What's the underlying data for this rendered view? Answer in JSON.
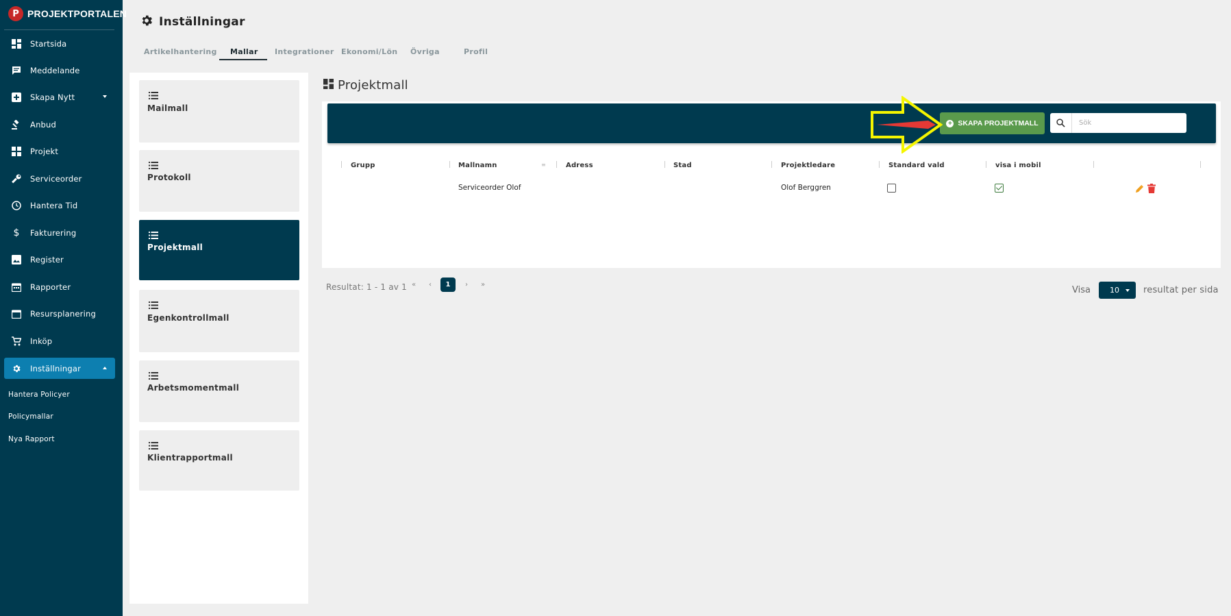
{
  "brand": {
    "logo_letter": "P",
    "name": "PROJEKTPORTALEN"
  },
  "sidebar": {
    "items": [
      {
        "label": "Startsida",
        "icon": "dashboard-icon"
      },
      {
        "label": "Meddelande",
        "icon": "message-icon"
      },
      {
        "label": "Skapa Nytt",
        "icon": "add-box-icon",
        "expandable": true
      },
      {
        "label": "Anbud",
        "icon": "gavel-icon"
      },
      {
        "label": "Projekt",
        "icon": "projects-icon"
      },
      {
        "label": "Serviceorder",
        "icon": "wrench-icon"
      },
      {
        "label": "Hantera Tid",
        "icon": "clock-icon"
      },
      {
        "label": "Fakturering",
        "icon": "dollar-icon"
      },
      {
        "label": "Register",
        "icon": "image-icon"
      },
      {
        "label": "Rapporter",
        "icon": "calendar-report-icon"
      },
      {
        "label": "Resursplanering",
        "icon": "calendar-icon"
      },
      {
        "label": "Inköp",
        "icon": "cart-icon"
      },
      {
        "label": "Inställningar",
        "icon": "gear-icon",
        "active": true,
        "expanded": true
      }
    ],
    "sub_items": [
      "Hantera Policyer",
      "Policymallar",
      "Nya Rapport"
    ]
  },
  "header": {
    "title": "Inställningar",
    "tabs": [
      "Artikelhantering",
      "Mallar",
      "Integrationer",
      "Ekonomi/Lön",
      "Övriga",
      "Profil"
    ],
    "active_tab": "Mallar"
  },
  "templates": {
    "items": [
      "Mailmall",
      "Protokoll",
      "Projektmall",
      "Egenkontrollmall",
      "Arbetsmomentmall",
      "Klientrapportmall"
    ],
    "active": "Projektmall"
  },
  "main": {
    "section_title": "Projektmall",
    "create_button": "SKAPA PROJEKTMALL",
    "search_placeholder": "Sök",
    "columns": [
      "Grupp",
      "Mallnamn",
      "Adress",
      "Stad",
      "Projektledare",
      "Standard vald",
      "visa i mobil"
    ],
    "rows": [
      {
        "grupp": "",
        "mallnamn": "Serviceorder Olof",
        "adress": "",
        "stad": "",
        "projektledare": "Olof Berggren",
        "standard_vald": false,
        "visa_i_mobil": true
      }
    ]
  },
  "pagination": {
    "result_text": "Resultat: 1 - 1 av 1",
    "first": "«",
    "prev": "‹",
    "current_page": "1",
    "next": "›",
    "last": "»",
    "visa_label": "Visa",
    "page_size": "10",
    "per_page_label": "resultat per sida"
  },
  "colors": {
    "sidebar_bg": "#003a4f",
    "active_nav": "#0d7fb0",
    "create_button": "#5a9a4c",
    "highlight_arrow": "#f5f500",
    "arrow_inner": "#e53935"
  }
}
